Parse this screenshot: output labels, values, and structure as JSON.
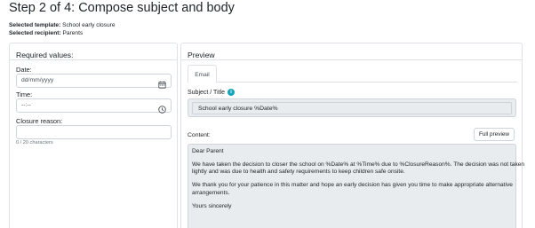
{
  "page": {
    "title": "Step 2 of 4: Compose subject and body",
    "selected_template_label": "Selected template:",
    "selected_template_value": "School early closure",
    "selected_recipient_label": "Selected recipient:",
    "selected_recipient_value": "Parents"
  },
  "required_values": {
    "heading": "Required values:",
    "fields": [
      {
        "label": "Date:",
        "value": "dd/mm/yyyy",
        "icon": "calendar-icon"
      },
      {
        "label": "Time:",
        "value": "--:--",
        "icon": "clock-icon"
      },
      {
        "label": "Closure reason:",
        "value": ""
      }
    ],
    "char_count": "0 / 20 characters"
  },
  "preview": {
    "heading": "Preview",
    "tabs": [
      "Email"
    ],
    "subject_label": "Subject / Title",
    "info_icon": "i",
    "subject_value": "School early closure %Date%",
    "content_label": "Content:",
    "full_preview_button": "Full preview",
    "content_lines": [
      "Dear Parent",
      "We have taken the decision to closer the school on %Date% at %Time% due to %ClosureReason%. The decision was not taken",
      "lightly and was due to health and safety requirements to keep children safe onsite.",
      "We thank you for your patience in this matter and hope an early decision has given you time to make appropriate alternative",
      "arrangements.",
      "Yours sincerely"
    ]
  },
  "colors": {
    "info_accent": "#17a2b8",
    "readonly_bg": "#e9ecef",
    "border": "#dee2e6"
  }
}
